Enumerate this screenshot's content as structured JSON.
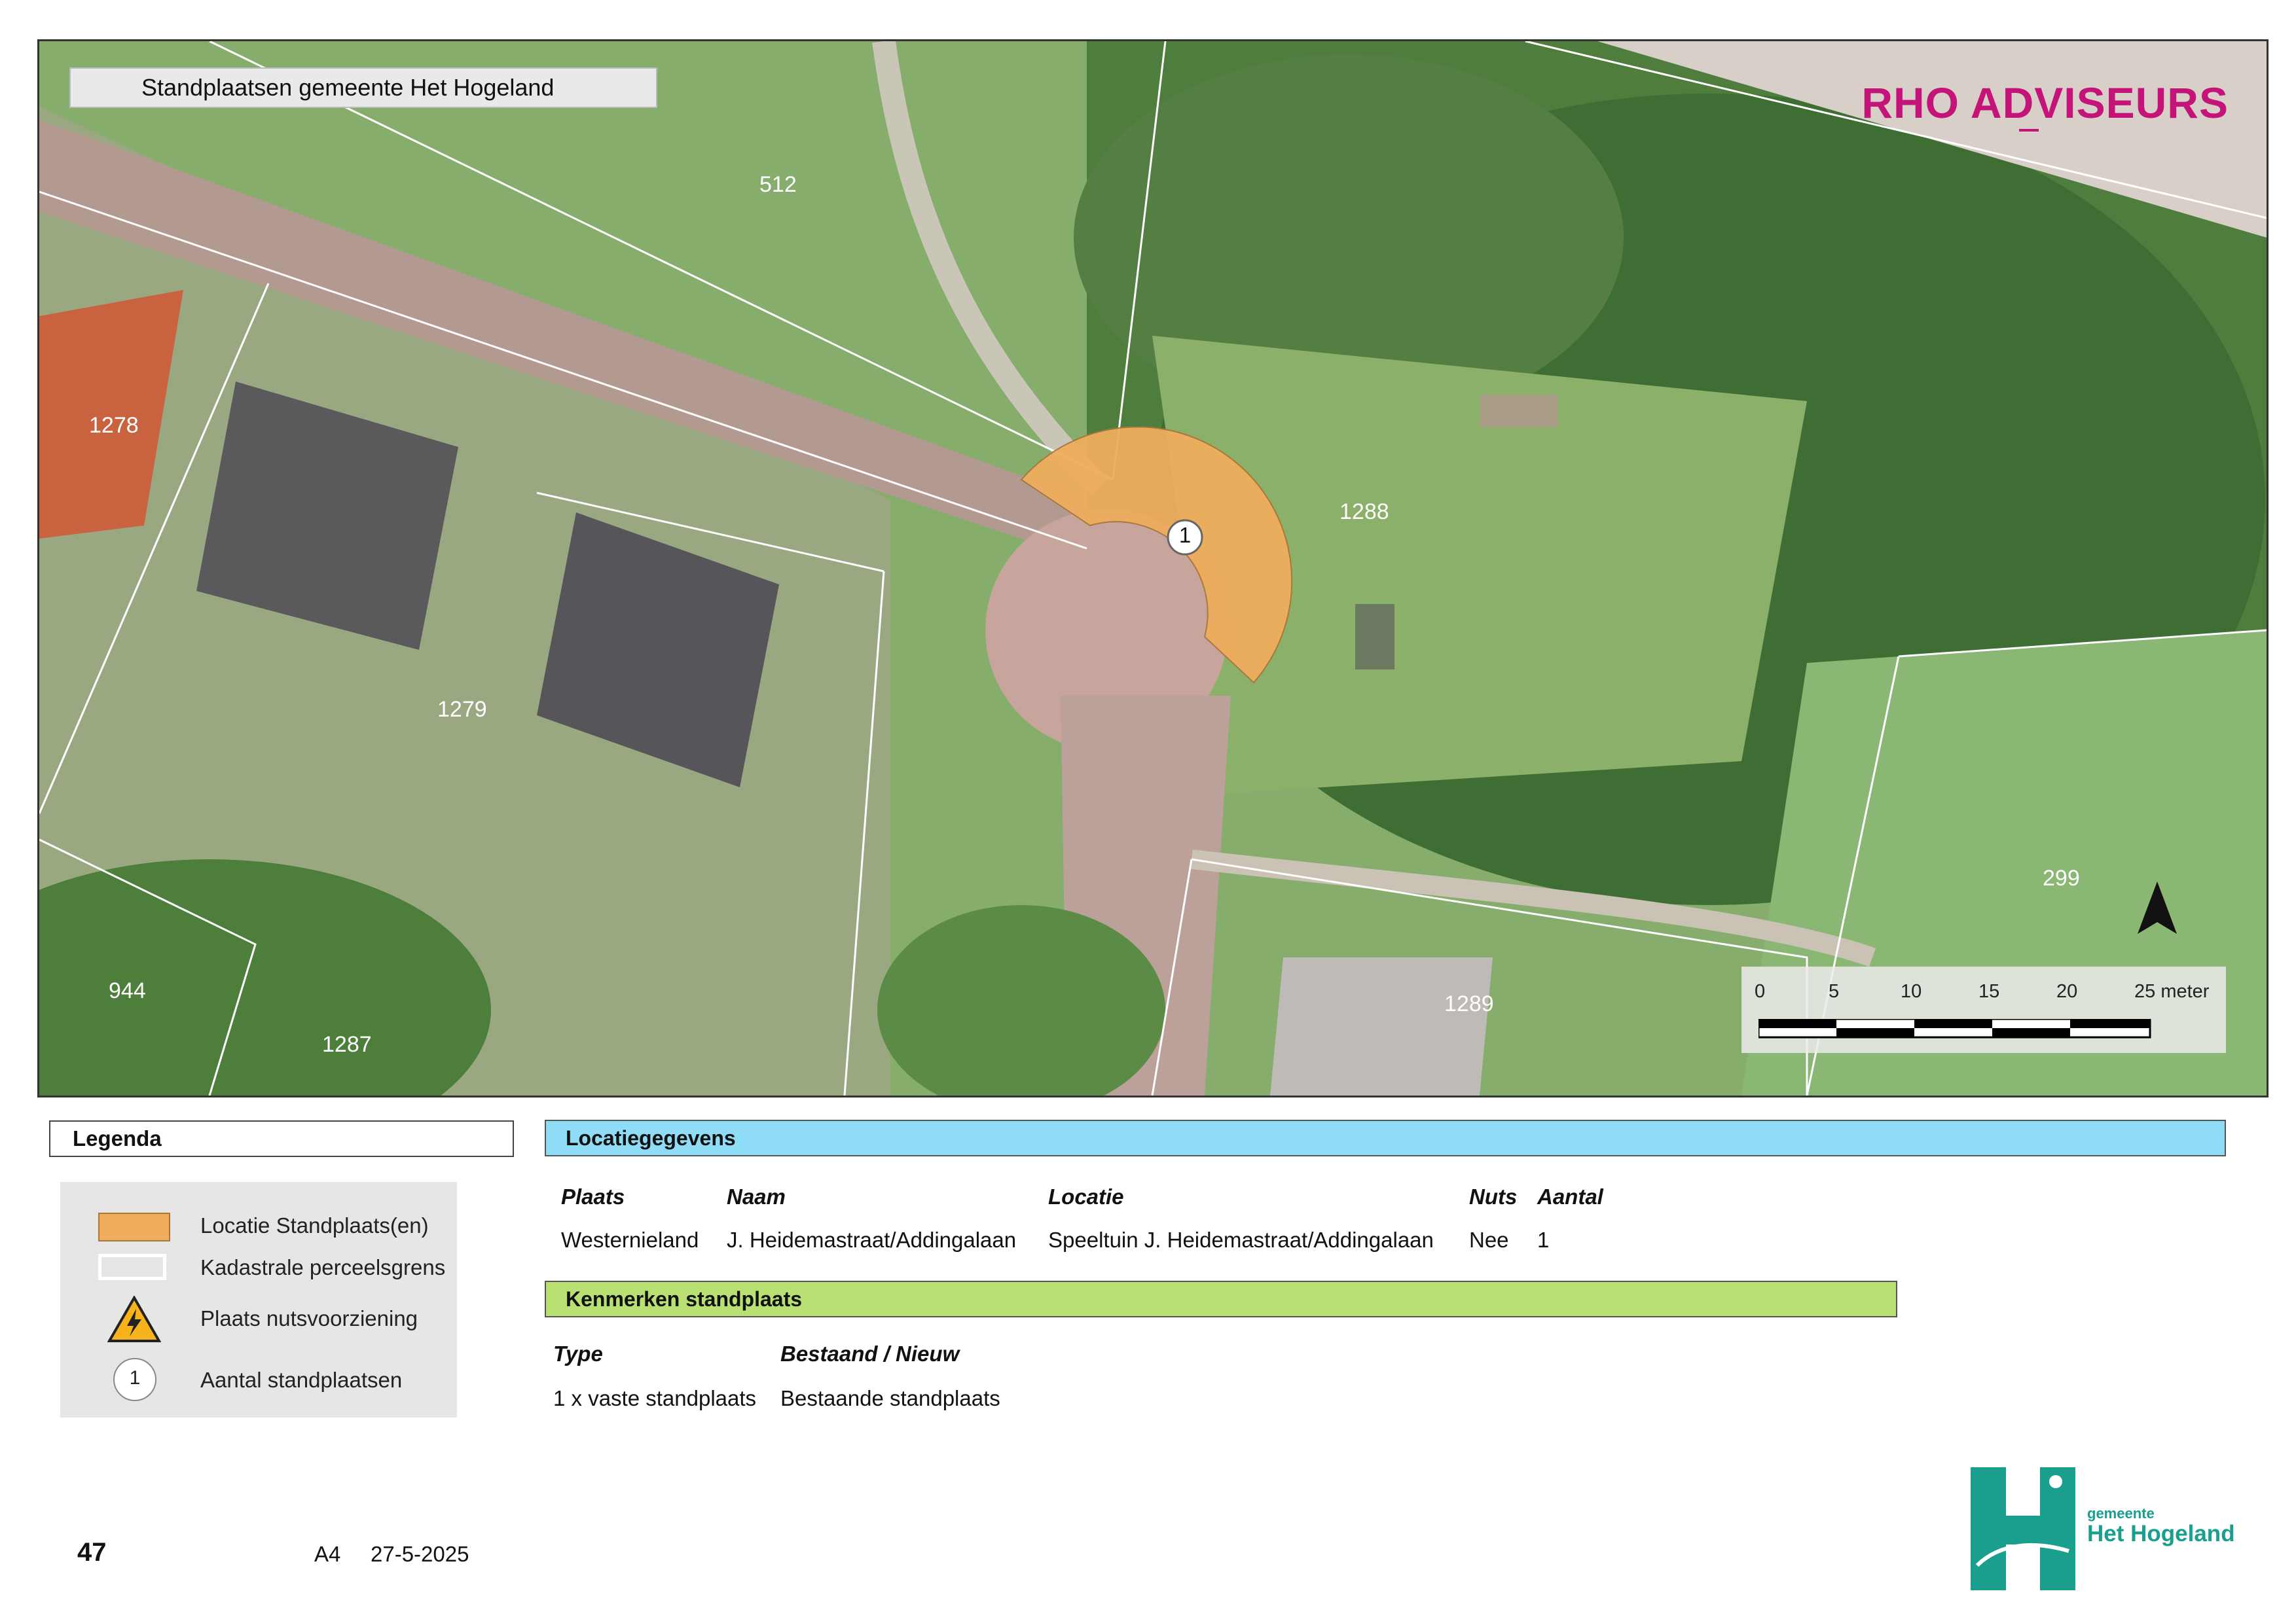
{
  "map": {
    "title": "Standplaatsen gemeente Het Hogeland",
    "brand": "RHO ADVISEURS",
    "parcels": [
      "512",
      "1278",
      "1288",
      "1279",
      "944",
      "1287",
      "1289",
      "299"
    ],
    "marker_label": "1",
    "scale": {
      "ticks": [
        "0",
        "5",
        "10",
        "15",
        "20"
      ],
      "last_tick": "25 meter"
    },
    "north_arrow": "north-arrow-icon"
  },
  "legend": {
    "title": "Legenda",
    "items": [
      {
        "label": "Locatie Standplaats(en)",
        "color": "#efad5d"
      },
      {
        "label": "Kadastrale perceelsgrens",
        "color": "#ffffff"
      },
      {
        "label": "Plaats nutsvoorziening",
        "icon": "electric-hazard-icon"
      },
      {
        "label": "Aantal standplaatsen",
        "symbol": "1"
      }
    ]
  },
  "location": {
    "title": "Locatiegegevens",
    "headers": [
      "Plaats",
      "Naam",
      "Locatie",
      "Nuts",
      "Aantal"
    ],
    "row": [
      "Westernieland",
      "J. Heidemastraat/Addingalaan",
      "Speeltuin J. Heidemastraat/Addingalaan",
      "Nee",
      "1"
    ]
  },
  "features": {
    "title": "Kenmerken standplaats",
    "headers": [
      "Type",
      "Bestaand / Nieuw"
    ],
    "row": [
      "1 x vaste standplaats",
      "Bestaande standplaats"
    ]
  },
  "footer": {
    "page_number": "47",
    "paper": "A4",
    "date": "27-5-2025",
    "municipality_small": "gemeente",
    "municipality_name": "Het Hogeland"
  },
  "colors": {
    "location_fill": "#efad5d",
    "brand": "#c4147a",
    "blue_bar": "#8edcf5",
    "green_bar": "#b8e073",
    "logo": "#1a9e8e"
  }
}
